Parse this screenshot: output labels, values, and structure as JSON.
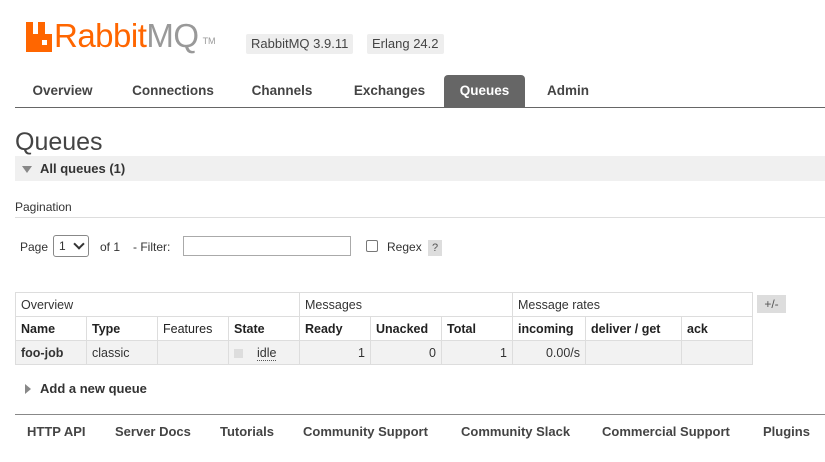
{
  "brand": {
    "name_orange": "Rabbit",
    "name_grey": "MQ",
    "tm": "TM"
  },
  "versions": {
    "rabbitmq": "RabbitMQ 3.9.11",
    "erlang": "Erlang 24.2"
  },
  "tabs": [
    {
      "label": "Overview"
    },
    {
      "label": "Connections"
    },
    {
      "label": "Channels"
    },
    {
      "label": "Exchanges"
    },
    {
      "label": "Queues",
      "active": true
    },
    {
      "label": "Admin"
    }
  ],
  "page": {
    "title": "Queues",
    "section": "All queues (1)"
  },
  "pagination": {
    "title": "Pagination",
    "page_label": "Page",
    "page_value": "1",
    "of_label": "of 1",
    "filter_label": "- Filter:",
    "filter_value": "",
    "regex_label": "Regex",
    "help": "?"
  },
  "table": {
    "groups": [
      "Overview",
      "Messages",
      "Message rates"
    ],
    "columns": [
      "Name",
      "Type",
      "Features",
      "State",
      "Ready",
      "Unacked",
      "Total",
      "incoming",
      "deliver / get",
      "ack"
    ],
    "rows": [
      {
        "name": "foo-job",
        "type": "classic",
        "features": "",
        "state": "idle",
        "ready": "1",
        "unacked": "0",
        "total": "1",
        "incoming": "0.00/s",
        "deliver_get": "",
        "ack": ""
      }
    ],
    "toggle": "+/-"
  },
  "add_queue": "Add a new queue",
  "footer": [
    "HTTP API",
    "Server Docs",
    "Tutorials",
    "Community Support",
    "Community Slack",
    "Commercial Support",
    "Plugins"
  ],
  "colors": {
    "brand": "#ff6600",
    "tab_active": "#666666"
  }
}
